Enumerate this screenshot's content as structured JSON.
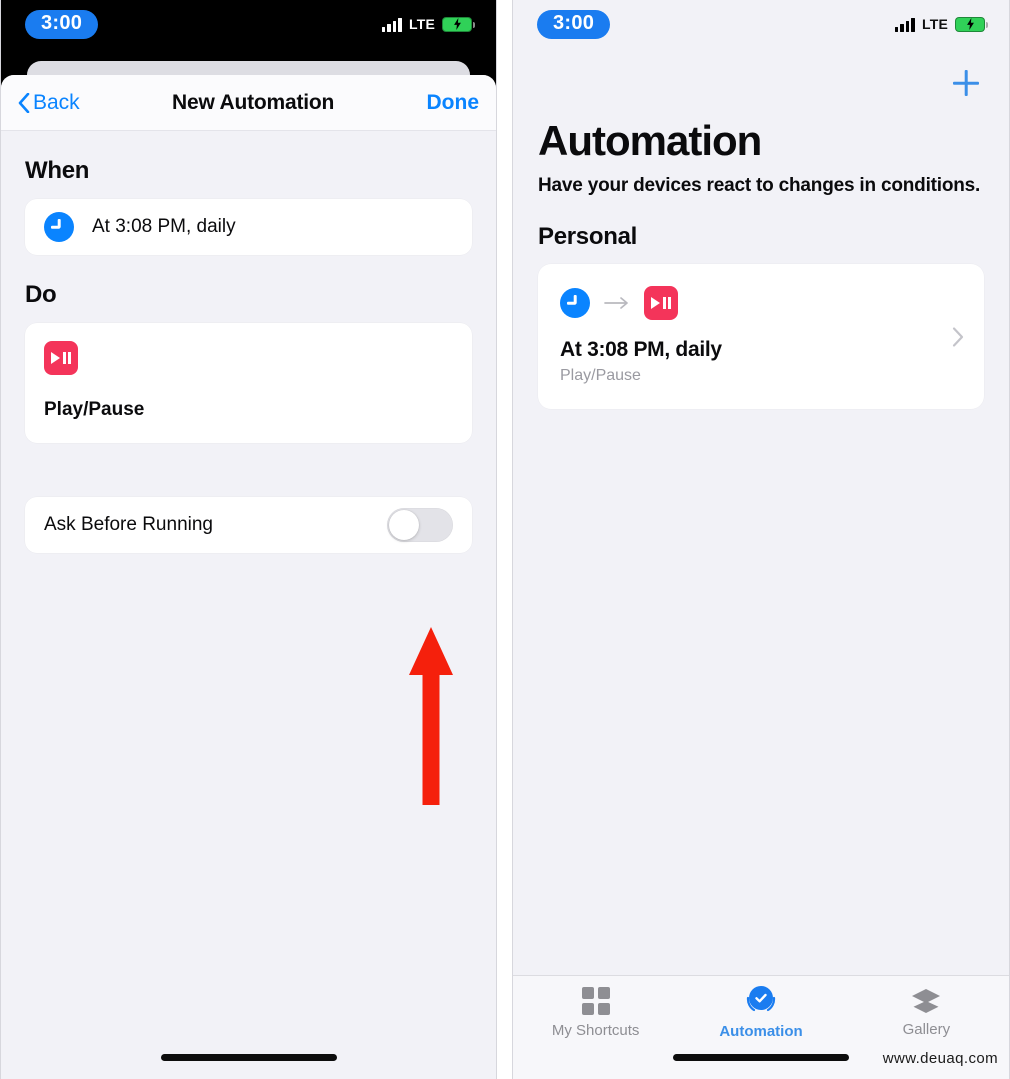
{
  "left_phone": {
    "status_bar": {
      "time": "3:00",
      "network_label": "LTE",
      "signal_icon": "cellular-bars-icon",
      "battery_icon": "battery-charging-icon"
    },
    "nav": {
      "back_label": "Back",
      "title": "New Automation",
      "done_label": "Done",
      "back_icon": "chevron-left-icon"
    },
    "sections": [
      {
        "heading": "When",
        "row_label": "At 3:08 PM, daily",
        "icon": "clock-icon"
      },
      {
        "heading": "Do",
        "row_label": "Play/Pause",
        "icon": "play-pause-icon"
      }
    ],
    "toggle_row": {
      "label": "Ask Before Running",
      "state": "off"
    },
    "annotation": {
      "type": "red-arrow",
      "color": "#f5200c",
      "points_to": "ask-before-running-toggle"
    }
  },
  "right_phone": {
    "status_bar": {
      "time": "3:00",
      "network_label": "LTE",
      "signal_icon": "cellular-bars-icon",
      "battery_icon": "battery-charging-icon"
    },
    "add_button_icon": "plus-icon",
    "title": "Automation",
    "subtitle": "Have your devices react to changes in conditions.",
    "group_heading": "Personal",
    "automation_card": {
      "trigger_icon": "clock-icon",
      "arrow_icon": "arrow-right-icon",
      "action_icon": "play-pause-icon",
      "title": "At 3:08 PM, daily",
      "subtitle": "Play/Pause",
      "disclosure_icon": "chevron-right-icon"
    },
    "tabbar": {
      "items": [
        {
          "label": "My Shortcuts",
          "icon": "grid-icon",
          "active": false
        },
        {
          "label": "Automation",
          "icon": "automation-check-icon",
          "active": true
        },
        {
          "label": "Gallery",
          "icon": "layers-icon",
          "active": false
        }
      ]
    }
  },
  "watermark": "www.deuaq.com",
  "colors": {
    "accent_blue": "#0a84ff",
    "tab_blue": "#3b8fe8",
    "time_pill_blue": "#1a7cf0",
    "red_action": "#f4345a",
    "annotation_red": "#f5200c",
    "battery_green": "#30d158",
    "page_background": "#f2f2f7",
    "card_white": "#ffffff",
    "muted_text": "#8e8e93"
  }
}
